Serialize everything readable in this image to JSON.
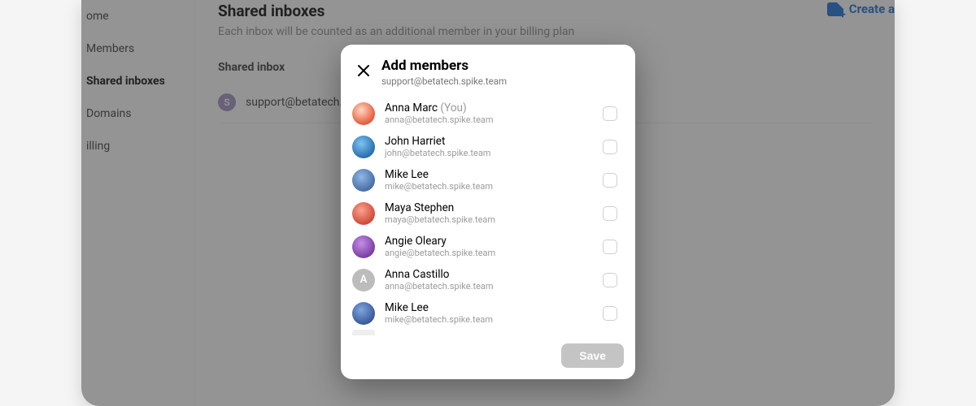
{
  "sidebar": {
    "items": [
      {
        "label": "ome"
      },
      {
        "label": "Members"
      },
      {
        "label": "Shared inboxes"
      },
      {
        "label": "Domains"
      },
      {
        "label": "illing"
      }
    ],
    "active_index": 2
  },
  "page": {
    "title": "Shared inboxes",
    "subtitle": "Each inbox will be counted as an additional member in your billing plan",
    "create_label": "Create a",
    "section_heading": "Shared inbox",
    "inbox": {
      "initial": "S",
      "email": "support@betatech.spike.t"
    }
  },
  "modal": {
    "title": "Add members",
    "subtitle": "support@betatech.spike.team",
    "save_label": "Save",
    "you_label": "(You)",
    "members": [
      {
        "name": "Anna Marc",
        "you": true,
        "email": "anna@betatech.spike.team",
        "avatar_class": "av-anna",
        "initial": ""
      },
      {
        "name": "John Harriet",
        "you": false,
        "email": "john@betatech.spike.team",
        "avatar_class": "av-john",
        "initial": ""
      },
      {
        "name": "Mike Lee",
        "you": false,
        "email": "mike@betatech.spike.team",
        "avatar_class": "av-mike1",
        "initial": ""
      },
      {
        "name": "Maya Stephen",
        "you": false,
        "email": "maya@betatech.spike.team",
        "avatar_class": "av-maya",
        "initial": ""
      },
      {
        "name": "Angie Oleary",
        "you": false,
        "email": "angie@betatech.spike.team",
        "avatar_class": "av-angie",
        "initial": ""
      },
      {
        "name": "Anna Castillo",
        "you": false,
        "email": "anna@betatech.spike.team",
        "avatar_class": "av-annac",
        "initial": "A"
      },
      {
        "name": "Mike Lee",
        "you": false,
        "email": "mike@betatech.spike.team",
        "avatar_class": "av-mike2",
        "initial": ""
      }
    ]
  }
}
